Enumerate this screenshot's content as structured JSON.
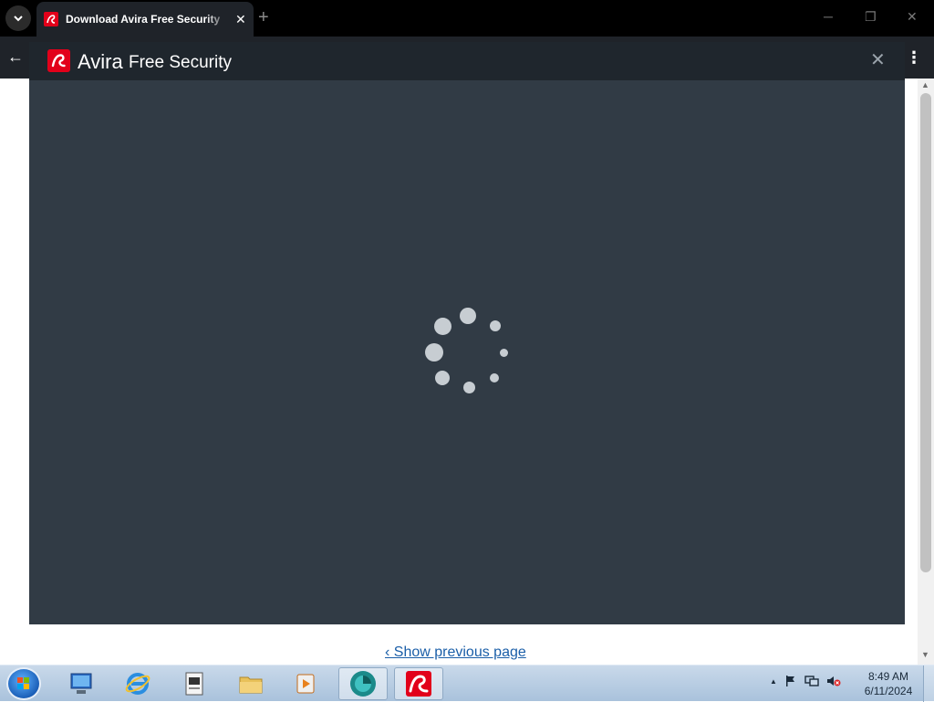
{
  "browser": {
    "tab_title": "Download Avira Free Security",
    "tab_close": "✕",
    "new_tab": "+",
    "back": "←",
    "menu": "⋮",
    "window_controls": {
      "minimize": "─",
      "restore": "❐",
      "close": "✕"
    }
  },
  "installer": {
    "brand_name": "Avira",
    "product_name": "Free Security",
    "close": "✕",
    "state": "loading",
    "brand_color": "#e2001a"
  },
  "page": {
    "prev_link": "‹ Show previous page"
  },
  "taskbar": {
    "items": [
      {
        "name": "windows-explorer",
        "icon": "computer-icon",
        "active": false
      },
      {
        "name": "internet-explorer",
        "icon": "ie-icon",
        "active": false
      },
      {
        "name": "document-viewer",
        "icon": "document-icon",
        "active": false
      },
      {
        "name": "file-explorer",
        "icon": "folder-icon",
        "active": false
      },
      {
        "name": "media-player",
        "icon": "media-player-icon",
        "active": false
      },
      {
        "name": "browser",
        "icon": "browser-icon",
        "active": true
      },
      {
        "name": "avira-installer",
        "icon": "avira-icon",
        "active": true
      }
    ],
    "tray": {
      "expand": "▲"
    },
    "clock": {
      "time": "8:49 AM",
      "date": "6/11/2024"
    }
  }
}
